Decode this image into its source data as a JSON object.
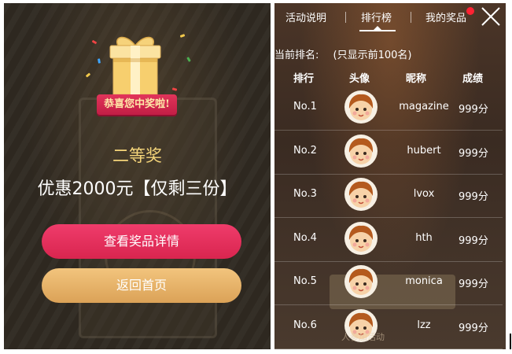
{
  "prize": {
    "congrats_badge": "恭喜您中奖啦!",
    "level": "二等奖",
    "description": "优惠2000元【仅剩三份】",
    "view_details_label": "查看奖品详情",
    "back_home_label": "返回首页"
  },
  "tabs": [
    {
      "label": "活动说明",
      "active": false
    },
    {
      "label": "排行榜",
      "active": true
    },
    {
      "label": "我的奖品",
      "active": false,
      "has_notification": true
    }
  ],
  "ranking": {
    "current_rank_label": "当前排名:",
    "note": "(只显示前100名)",
    "headers": {
      "rank": "排行",
      "avatar": "头像",
      "nickname": "昵称",
      "score": "成绩"
    },
    "rows": [
      {
        "rank": "No.1",
        "nickname": "magazine",
        "score": "999分"
      },
      {
        "rank": "No.2",
        "nickname": "hubert",
        "score": "999分"
      },
      {
        "rank": "No.3",
        "nickname": "lvox",
        "score": "999分"
      },
      {
        "rank": "No.4",
        "nickname": "hth",
        "score": "999分"
      },
      {
        "rank": "No.5",
        "nickname": "monica",
        "score": "999分"
      },
      {
        "rank": "No.6",
        "nickname": "lzz",
        "score": "999分"
      }
    ],
    "footer": "人参加活动"
  },
  "colors": {
    "accent_pink": "#e23058",
    "accent_gold": "#dba257",
    "prize_level_text": "#f5d57a",
    "notification": "#ff2233"
  }
}
